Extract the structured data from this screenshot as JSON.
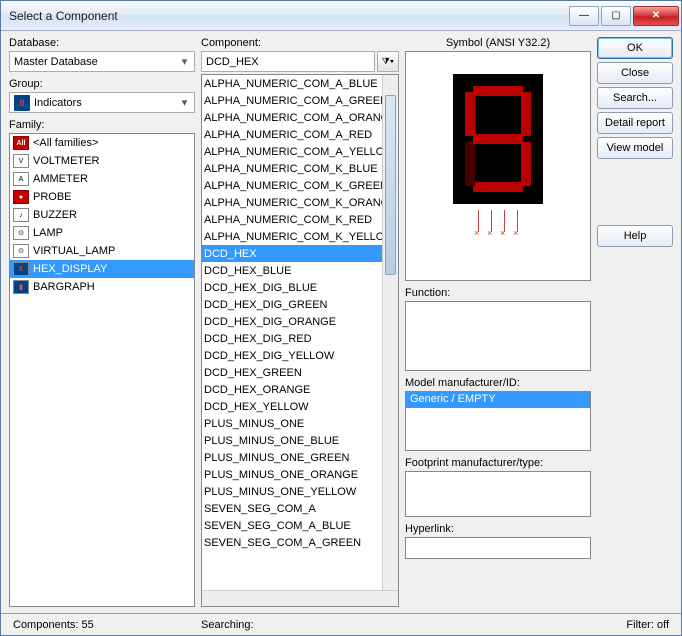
{
  "window": {
    "title": "Select a Component"
  },
  "labels": {
    "database": "Database:",
    "group": "Group:",
    "family": "Family:",
    "component": "Component:",
    "symbol": "Symbol (ANSI Y32.2)",
    "function": "Function:",
    "model_mfr": "Model manufacturer/ID:",
    "footprint": "Footprint manufacturer/type:",
    "hyperlink": "Hyperlink:"
  },
  "database": {
    "selected": "Master Database"
  },
  "group": {
    "selected": "Indicators"
  },
  "family": {
    "items": [
      {
        "label": "<All families>",
        "icon": "All",
        "iconClass": "allicon"
      },
      {
        "label": "VOLTMETER",
        "icon": "V"
      },
      {
        "label": "AMMETER",
        "icon": "A"
      },
      {
        "label": "PROBE",
        "icon": "●",
        "iconStyle": "background:#c00;color:#fff;border-color:#800"
      },
      {
        "label": "BUZZER",
        "icon": "♪"
      },
      {
        "label": "LAMP",
        "icon": "⊙"
      },
      {
        "label": "VIRTUAL_LAMP",
        "icon": "⊙"
      },
      {
        "label": "HEX_DISPLAY",
        "icon": "8",
        "selected": true,
        "iconStyle": "background:#048;color:#f44"
      },
      {
        "label": "BARGRAPH",
        "icon": "▮",
        "iconStyle": "background:#048;color:#f44"
      }
    ]
  },
  "component": {
    "filter_value": "DCD_HEX",
    "items": [
      "ALPHA_NUMERIC_COM_A_BLUE",
      "ALPHA_NUMERIC_COM_A_GREEN",
      "ALPHA_NUMERIC_COM_A_ORANGE",
      "ALPHA_NUMERIC_COM_A_RED",
      "ALPHA_NUMERIC_COM_A_YELLOW",
      "ALPHA_NUMERIC_COM_K_BLUE",
      "ALPHA_NUMERIC_COM_K_GREEN",
      "ALPHA_NUMERIC_COM_K_ORANGE",
      "ALPHA_NUMERIC_COM_K_RED",
      "ALPHA_NUMERIC_COM_K_YELLOW",
      "DCD_HEX",
      "DCD_HEX_BLUE",
      "DCD_HEX_DIG_BLUE",
      "DCD_HEX_DIG_GREEN",
      "DCD_HEX_DIG_ORANGE",
      "DCD_HEX_DIG_RED",
      "DCD_HEX_DIG_YELLOW",
      "DCD_HEX_GREEN",
      "DCD_HEX_ORANGE",
      "DCD_HEX_YELLOW",
      "PLUS_MINUS_ONE",
      "PLUS_MINUS_ONE_BLUE",
      "PLUS_MINUS_ONE_GREEN",
      "PLUS_MINUS_ONE_ORANGE",
      "PLUS_MINUS_ONE_YELLOW",
      "SEVEN_SEG_COM_A",
      "SEVEN_SEG_COM_A_BLUE",
      "SEVEN_SEG_COM_A_GREEN"
    ],
    "selected_index": 10
  },
  "model_mfr": {
    "value": "Generic / EMPTY"
  },
  "buttons": {
    "ok": "OK",
    "close": "Close",
    "search": "Search...",
    "detail": "Detail report",
    "view_model": "View model",
    "help": "Help"
  },
  "status": {
    "components": "Components: 55",
    "searching": "Searching:",
    "filter": "Filter: off"
  }
}
